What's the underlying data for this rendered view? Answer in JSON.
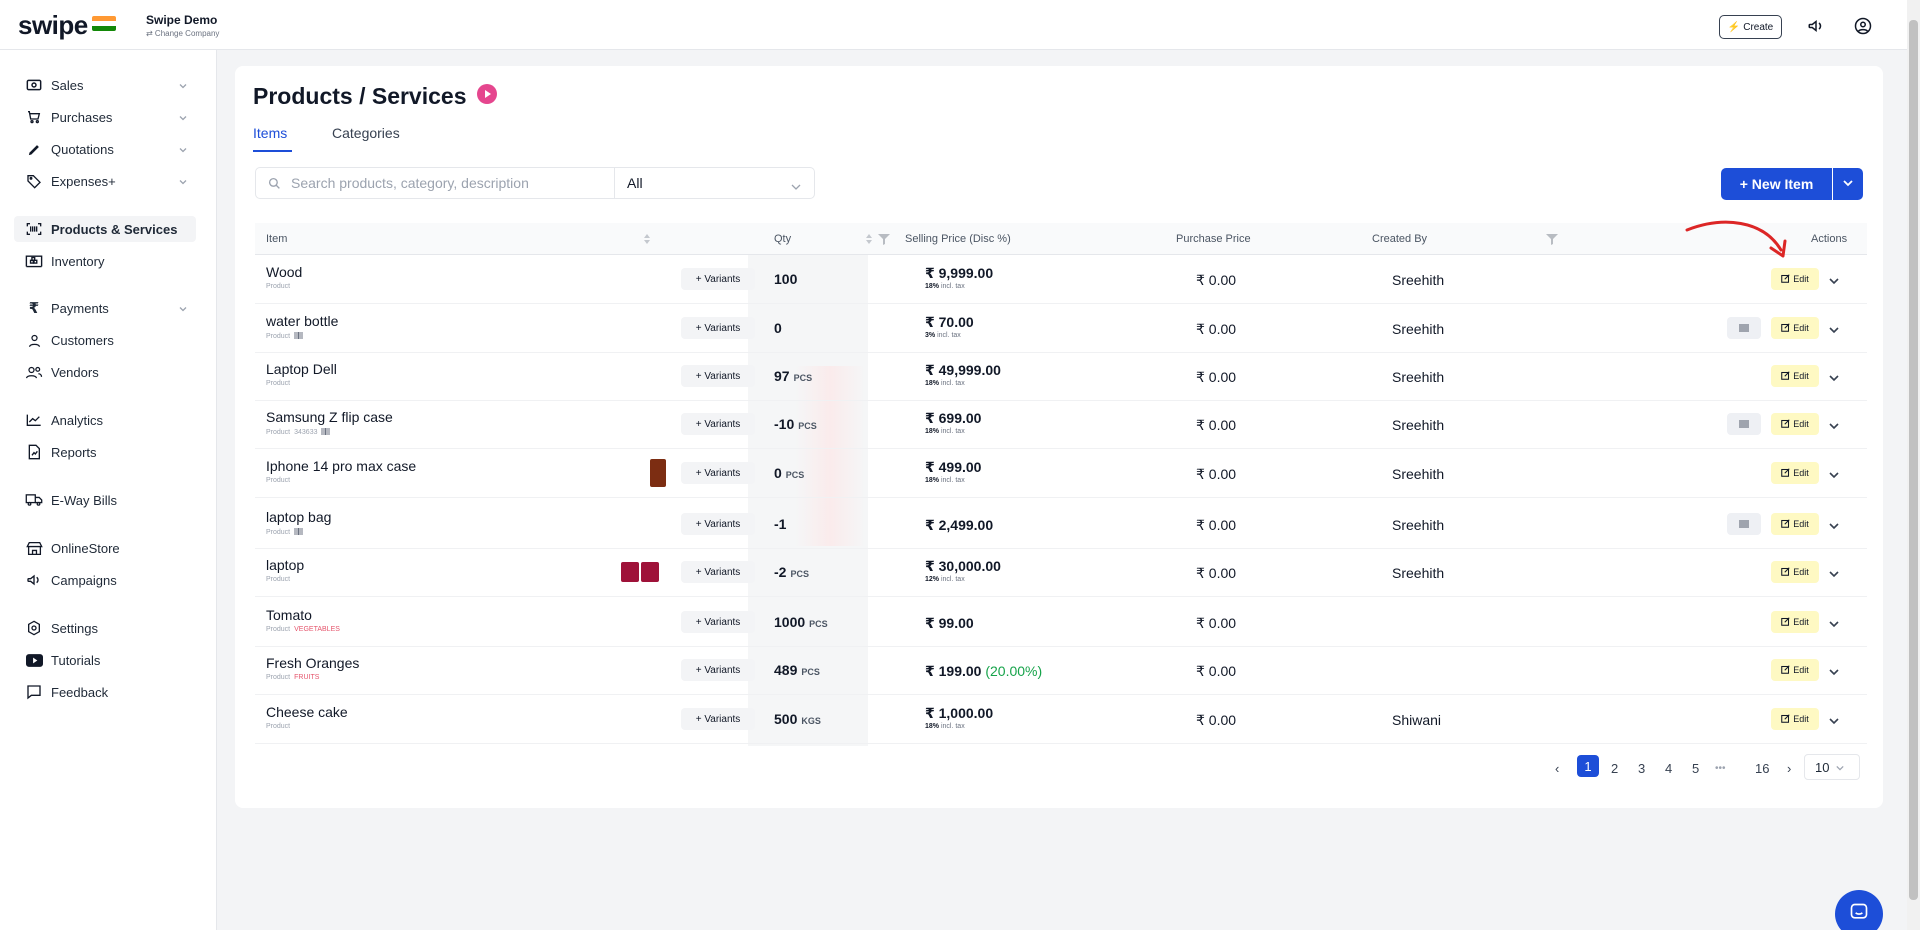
{
  "brand": {
    "logo": "swipe",
    "company_name": "Swipe Demo",
    "company_sub": "⇄ Change Company"
  },
  "topbar": {
    "create_label": "Create"
  },
  "sidebar": {
    "items": [
      {
        "label": "Sales",
        "icon": "cash-icon"
      },
      {
        "label": "Purchases",
        "icon": "cart-icon"
      },
      {
        "label": "Quotations",
        "icon": "pen-icon"
      },
      {
        "label": "Expenses+",
        "icon": "tag-icon"
      },
      {
        "label": "Products & Services",
        "icon": "barcode-scan-icon"
      },
      {
        "label": "Inventory",
        "icon": "warehouse-icon"
      },
      {
        "label": "Payments",
        "icon": "rupee-icon"
      },
      {
        "label": "Customers",
        "icon": "user-icon"
      },
      {
        "label": "Vendors",
        "icon": "users-icon"
      },
      {
        "label": "Analytics",
        "icon": "chart-icon"
      },
      {
        "label": "Reports",
        "icon": "report-icon"
      },
      {
        "label": "E-Way Bills",
        "icon": "truck-icon"
      },
      {
        "label": "OnlineStore",
        "icon": "store-icon"
      },
      {
        "label": "Campaigns",
        "icon": "megaphone-icon"
      },
      {
        "label": "Settings",
        "icon": "settings-icon"
      },
      {
        "label": "Tutorials",
        "icon": "youtube-icon"
      },
      {
        "label": "Feedback",
        "icon": "message-icon"
      }
    ]
  },
  "page": {
    "title": "Products / Services"
  },
  "tabs": {
    "items": "Items",
    "categories": "Categories"
  },
  "search": {
    "placeholder": "Search products, category, description"
  },
  "filter": {
    "selected": "All"
  },
  "actions": {
    "new_item": "+ New Item"
  },
  "table": {
    "headers": {
      "item": "Item",
      "qty": "Qty",
      "selling_price": "Selling Price (Disc %)",
      "purchase_price": "Purchase Price",
      "created_by": "Created By",
      "actions": "Actions"
    },
    "variants_label": "+ Variants",
    "edit_label": "Edit",
    "rows": [
      {
        "name": "Wood",
        "type": "Product",
        "category": "",
        "code": "",
        "qty": "100",
        "unit": "",
        "price": "₹ 9,999.00",
        "disc": "",
        "tax": "18%",
        "purchase": "₹ 0.00",
        "created": "Sreehith"
      },
      {
        "name": "water bottle",
        "type": "Product",
        "category": "",
        "code": "",
        "qty": "0",
        "unit": "",
        "price": "₹ 70.00",
        "disc": "",
        "tax": "3%",
        "purchase": "₹ 0.00",
        "created": "Sreehith"
      },
      {
        "name": "Laptop Dell",
        "type": "Product",
        "category": "",
        "code": "",
        "qty": "97",
        "unit": "PCS",
        "price": "₹ 49,999.00",
        "disc": "",
        "tax": "18%",
        "purchase": "₹ 0.00",
        "created": "Sreehith"
      },
      {
        "name": "Samsung Z flip case",
        "type": "Product",
        "category": "",
        "code": "343633",
        "qty": "-10",
        "unit": "PCS",
        "price": "₹ 699.00",
        "disc": "",
        "tax": "18%",
        "purchase": "₹ 0.00",
        "created": "Sreehith"
      },
      {
        "name": "Iphone 14 pro max case",
        "type": "Product",
        "category": "",
        "code": "",
        "qty": "0",
        "unit": "PCS",
        "price": "₹ 499.00",
        "disc": "",
        "tax": "18%",
        "purchase": "₹ 0.00",
        "created": "Sreehith"
      },
      {
        "name": "laptop bag",
        "type": "Product",
        "category": "",
        "code": "",
        "qty": "-1",
        "unit": "",
        "price": "₹ 2,499.00",
        "disc": "",
        "tax": "",
        "purchase": "₹ 0.00",
        "created": "Sreehith"
      },
      {
        "name": "laptop",
        "type": "Product",
        "category": "",
        "code": "",
        "qty": "-2",
        "unit": "PCS",
        "price": "₹ 30,000.00",
        "disc": "",
        "tax": "12%",
        "purchase": "₹ 0.00",
        "created": "Sreehith"
      },
      {
        "name": "Tomato",
        "type": "Product",
        "category": "VEGETABLES",
        "code": "",
        "qty": "1000",
        "unit": "PCS",
        "price": "₹ 99.00",
        "disc": "",
        "tax": "",
        "purchase": "₹ 0.00",
        "created": ""
      },
      {
        "name": "Fresh Oranges",
        "type": "Product",
        "category": "FRUITS",
        "code": "",
        "qty": "489",
        "unit": "PCS",
        "price": "₹ 199.00",
        "disc": "(20.00%)",
        "tax": "",
        "purchase": "₹ 0.00",
        "created": ""
      },
      {
        "name": "Cheese cake",
        "type": "Product",
        "category": "",
        "code": "",
        "qty": "500",
        "unit": "KGS",
        "price": "₹ 1,000.00",
        "disc": "",
        "tax": "18%",
        "purchase": "₹ 0.00",
        "created": "Shiwani"
      }
    ],
    "tax_suffix": "incl. tax"
  },
  "pagination": {
    "pages": [
      "1",
      "2",
      "3",
      "4",
      "5",
      "•••",
      "16"
    ],
    "page_size": "10"
  },
  "colors": {
    "accent": "#1d4ed8",
    "edit_bg": "#fef9c3",
    "annotation_arrow": "#dc2626"
  }
}
